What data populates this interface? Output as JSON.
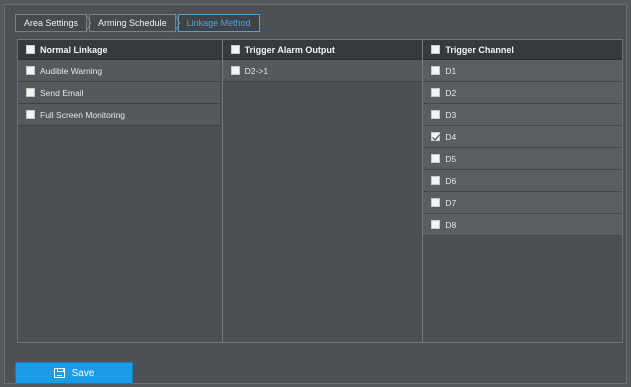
{
  "tabs": [
    {
      "label": "Area Settings"
    },
    {
      "label": "Arming Schedule"
    },
    {
      "label": "Linkage Method"
    }
  ],
  "normal_linkage": {
    "header": "Normal Linkage",
    "items": [
      {
        "label": "Audible Warning",
        "checked": false
      },
      {
        "label": "Send Email",
        "checked": false
      },
      {
        "label": "Full Screen Monitoring",
        "checked": false
      }
    ]
  },
  "trigger_alarm_output": {
    "header": "Trigger Alarm Output",
    "items": [
      {
        "label": "D2->1",
        "checked": false
      }
    ]
  },
  "trigger_channel": {
    "header": "Trigger Channel",
    "items": [
      {
        "label": "D1",
        "checked": false
      },
      {
        "label": "D2",
        "checked": false
      },
      {
        "label": "D3",
        "checked": false
      },
      {
        "label": "D4",
        "checked": true
      },
      {
        "label": "D5",
        "checked": false
      },
      {
        "label": "D6",
        "checked": false
      },
      {
        "label": "D7",
        "checked": false
      },
      {
        "label": "D8",
        "checked": false
      }
    ]
  },
  "save_button": {
    "label": "Save",
    "icon": "save-icon"
  },
  "colors": {
    "accent": "#1c9be6",
    "active_tab": "#4fa3d9",
    "background": "#4d5054"
  }
}
